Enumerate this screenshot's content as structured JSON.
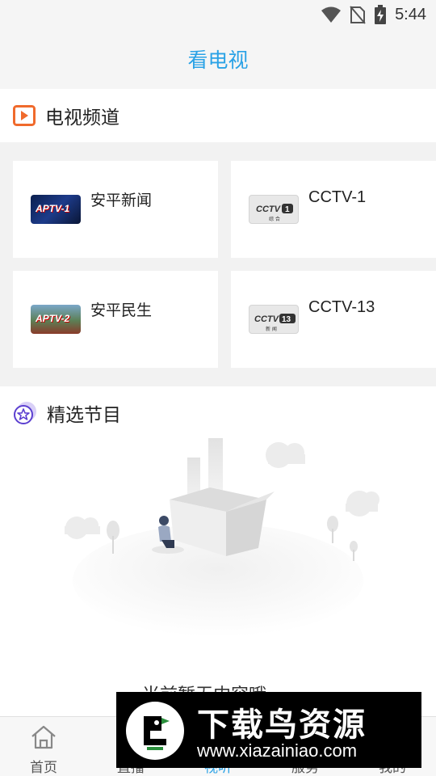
{
  "status_bar": {
    "time": "5:44",
    "icons": [
      "wifi-icon",
      "no-sim-icon",
      "battery-charging-icon"
    ]
  },
  "header": {
    "title": "看电视"
  },
  "tv_section": {
    "title": "电视频道",
    "icon": "play-square-icon",
    "channels": [
      {
        "name": "安平新闻",
        "logo": "APTV-1"
      },
      {
        "name": "CCTV-1",
        "logo": "CCTV1 综合"
      },
      {
        "name": "安平民生",
        "logo": "APTV-2"
      },
      {
        "name": "CCTV-13",
        "logo": "CCTV13 新闻"
      }
    ]
  },
  "featured_section": {
    "title": "精选节目",
    "icon": "star-circle-icon",
    "empty_text": "当前暂无内容哦"
  },
  "tabbar": {
    "items": [
      {
        "label": "首页",
        "icon": "home-icon",
        "active": false
      },
      {
        "label": "直播",
        "icon": "live-icon",
        "active": false
      },
      {
        "label": "视听",
        "icon": "tv-icon",
        "active": true
      },
      {
        "label": "服务",
        "icon": "service-icon",
        "active": false
      },
      {
        "label": "我的",
        "icon": "user-icon",
        "active": false
      }
    ]
  },
  "watermark": {
    "text": "下载鸟资源",
    "url": "www.xiazainiao.com"
  },
  "colors": {
    "accent": "#2aa2e6",
    "section_icon_orange": "#f06a2c",
    "section_icon_purple": "#5b3fd0"
  }
}
